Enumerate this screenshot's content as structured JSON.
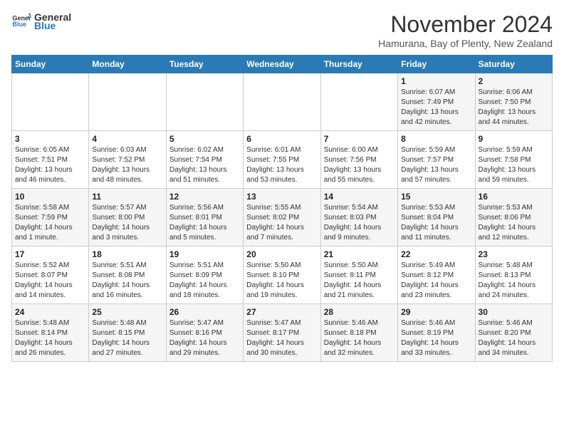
{
  "header": {
    "logo_general": "General",
    "logo_blue": "Blue",
    "title": "November 2024",
    "subtitle": "Hamurana, Bay of Plenty, New Zealand"
  },
  "columns": [
    "Sunday",
    "Monday",
    "Tuesday",
    "Wednesday",
    "Thursday",
    "Friday",
    "Saturday"
  ],
  "weeks": [
    [
      {
        "day": "",
        "info": ""
      },
      {
        "day": "",
        "info": ""
      },
      {
        "day": "",
        "info": ""
      },
      {
        "day": "",
        "info": ""
      },
      {
        "day": "",
        "info": ""
      },
      {
        "day": "1",
        "info": "Sunrise: 6:07 AM\nSunset: 7:49 PM\nDaylight: 13 hours and 42 minutes."
      },
      {
        "day": "2",
        "info": "Sunrise: 6:06 AM\nSunset: 7:50 PM\nDaylight: 13 hours and 44 minutes."
      }
    ],
    [
      {
        "day": "3",
        "info": "Sunrise: 6:05 AM\nSunset: 7:51 PM\nDaylight: 13 hours and 46 minutes."
      },
      {
        "day": "4",
        "info": "Sunrise: 6:03 AM\nSunset: 7:52 PM\nDaylight: 13 hours and 48 minutes."
      },
      {
        "day": "5",
        "info": "Sunrise: 6:02 AM\nSunset: 7:54 PM\nDaylight: 13 hours and 51 minutes."
      },
      {
        "day": "6",
        "info": "Sunrise: 6:01 AM\nSunset: 7:55 PM\nDaylight: 13 hours and 53 minutes."
      },
      {
        "day": "7",
        "info": "Sunrise: 6:00 AM\nSunset: 7:56 PM\nDaylight: 13 hours and 55 minutes."
      },
      {
        "day": "8",
        "info": "Sunrise: 5:59 AM\nSunset: 7:57 PM\nDaylight: 13 hours and 57 minutes."
      },
      {
        "day": "9",
        "info": "Sunrise: 5:59 AM\nSunset: 7:58 PM\nDaylight: 13 hours and 59 minutes."
      }
    ],
    [
      {
        "day": "10",
        "info": "Sunrise: 5:58 AM\nSunset: 7:59 PM\nDaylight: 14 hours and 1 minute."
      },
      {
        "day": "11",
        "info": "Sunrise: 5:57 AM\nSunset: 8:00 PM\nDaylight: 14 hours and 3 minutes."
      },
      {
        "day": "12",
        "info": "Sunrise: 5:56 AM\nSunset: 8:01 PM\nDaylight: 14 hours and 5 minutes."
      },
      {
        "day": "13",
        "info": "Sunrise: 5:55 AM\nSunset: 8:02 PM\nDaylight: 14 hours and 7 minutes."
      },
      {
        "day": "14",
        "info": "Sunrise: 5:54 AM\nSunset: 8:03 PM\nDaylight: 14 hours and 9 minutes."
      },
      {
        "day": "15",
        "info": "Sunrise: 5:53 AM\nSunset: 8:04 PM\nDaylight: 14 hours and 11 minutes."
      },
      {
        "day": "16",
        "info": "Sunrise: 5:53 AM\nSunset: 8:06 PM\nDaylight: 14 hours and 12 minutes."
      }
    ],
    [
      {
        "day": "17",
        "info": "Sunrise: 5:52 AM\nSunset: 8:07 PM\nDaylight: 14 hours and 14 minutes."
      },
      {
        "day": "18",
        "info": "Sunrise: 5:51 AM\nSunset: 8:08 PM\nDaylight: 14 hours and 16 minutes."
      },
      {
        "day": "19",
        "info": "Sunrise: 5:51 AM\nSunset: 8:09 PM\nDaylight: 14 hours and 18 minutes."
      },
      {
        "day": "20",
        "info": "Sunrise: 5:50 AM\nSunset: 8:10 PM\nDaylight: 14 hours and 19 minutes."
      },
      {
        "day": "21",
        "info": "Sunrise: 5:50 AM\nSunset: 8:11 PM\nDaylight: 14 hours and 21 minutes."
      },
      {
        "day": "22",
        "info": "Sunrise: 5:49 AM\nSunset: 8:12 PM\nDaylight: 14 hours and 23 minutes."
      },
      {
        "day": "23",
        "info": "Sunrise: 5:48 AM\nSunset: 8:13 PM\nDaylight: 14 hours and 24 minutes."
      }
    ],
    [
      {
        "day": "24",
        "info": "Sunrise: 5:48 AM\nSunset: 8:14 PM\nDaylight: 14 hours and 26 minutes."
      },
      {
        "day": "25",
        "info": "Sunrise: 5:48 AM\nSunset: 8:15 PM\nDaylight: 14 hours and 27 minutes."
      },
      {
        "day": "26",
        "info": "Sunrise: 5:47 AM\nSunset: 8:16 PM\nDaylight: 14 hours and 29 minutes."
      },
      {
        "day": "27",
        "info": "Sunrise: 5:47 AM\nSunset: 8:17 PM\nDaylight: 14 hours and 30 minutes."
      },
      {
        "day": "28",
        "info": "Sunrise: 5:46 AM\nSunset: 8:18 PM\nDaylight: 14 hours and 32 minutes."
      },
      {
        "day": "29",
        "info": "Sunrise: 5:46 AM\nSunset: 8:19 PM\nDaylight: 14 hours and 33 minutes."
      },
      {
        "day": "30",
        "info": "Sunrise: 5:46 AM\nSunset: 8:20 PM\nDaylight: 14 hours and 34 minutes."
      }
    ]
  ]
}
